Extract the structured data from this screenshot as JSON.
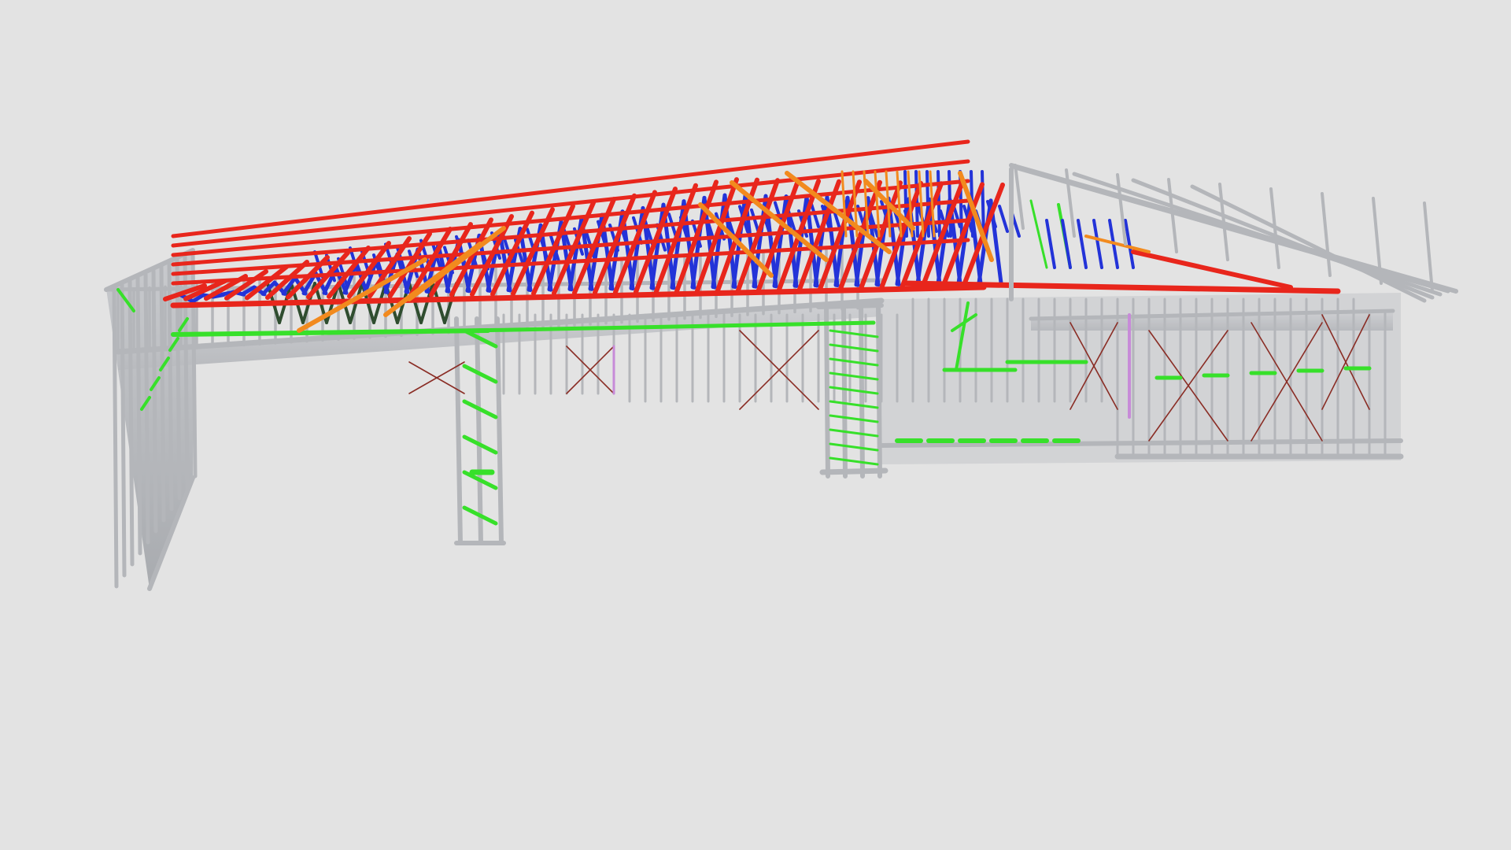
{
  "viewer": {
    "background_color": "#e3e3e3",
    "model": {
      "subject": "steel-frame-house-3d-model",
      "member_colors": {
        "wall_frame": "#b4b6ba",
        "top_chord": "#e8261c",
        "web_member": "#2333d8",
        "rafter": "#f28a1e",
        "noggin_brace": "#37e02a",
        "strap_brace": "#8a2d25",
        "accent": "#c78bd8",
        "dark_web": "#2f4d2f"
      }
    }
  }
}
